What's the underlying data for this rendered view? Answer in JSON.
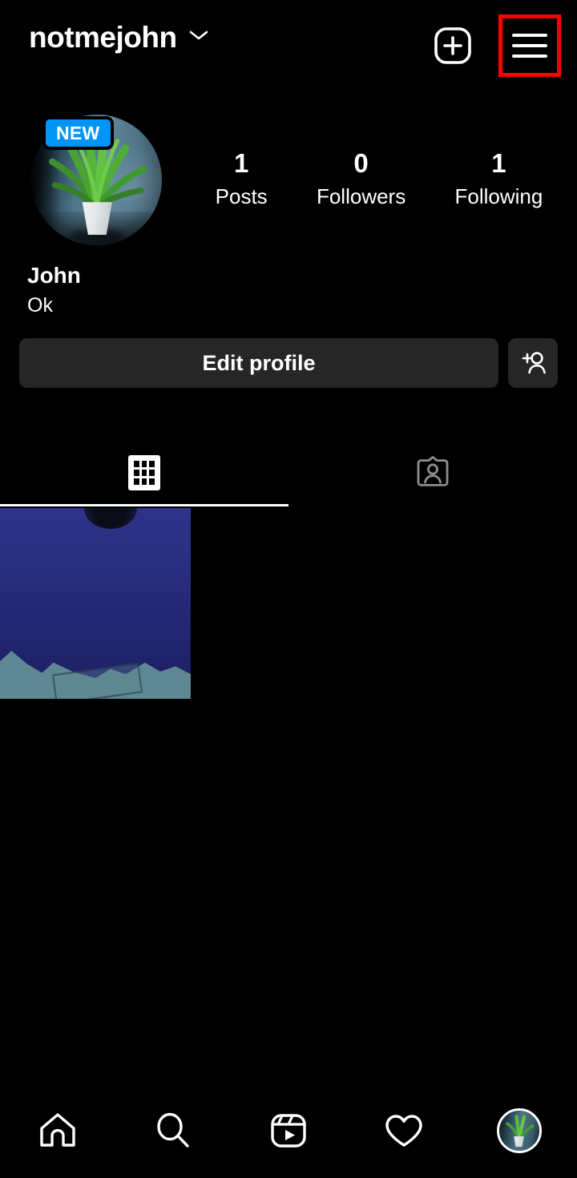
{
  "header": {
    "username": "notmejohn",
    "chevron_icon": "chevron-down-icon",
    "create_icon": "plus-square-icon",
    "menu_icon": "hamburger-menu-icon",
    "highlight_color": "#FF0000"
  },
  "profile": {
    "avatar_icon": "profile-avatar-plant-photo",
    "new_badge": "NEW",
    "new_badge_color": "#0095F6",
    "display_name": "John",
    "bio": "Ok",
    "stats": [
      {
        "count": "1",
        "label": "Posts"
      },
      {
        "count": "0",
        "label": "Followers"
      },
      {
        "count": "1",
        "label": "Following"
      }
    ]
  },
  "actions": {
    "edit_profile_label": "Edit profile",
    "add_person_icon": "add-person-icon"
  },
  "tabs": [
    {
      "name": "grid-tab",
      "icon": "grid-icon",
      "active": true
    },
    {
      "name": "tagged-tab",
      "icon": "tagged-person-icon",
      "active": false
    }
  ],
  "posts": [
    {
      "name": "post-thumbnail-1",
      "description": "night-sky-mountains"
    }
  ],
  "bottom_nav": [
    {
      "name": "home",
      "icon": "home-icon"
    },
    {
      "name": "search",
      "icon": "search-icon"
    },
    {
      "name": "reels",
      "icon": "reels-icon"
    },
    {
      "name": "activity",
      "icon": "heart-icon"
    },
    {
      "name": "profile",
      "icon": "profile-avatar-icon"
    }
  ],
  "colors": {
    "background": "#000000",
    "button_bg": "#262626",
    "accent_blue": "#0095F6",
    "inactive_gray": "#8E8E8E"
  }
}
